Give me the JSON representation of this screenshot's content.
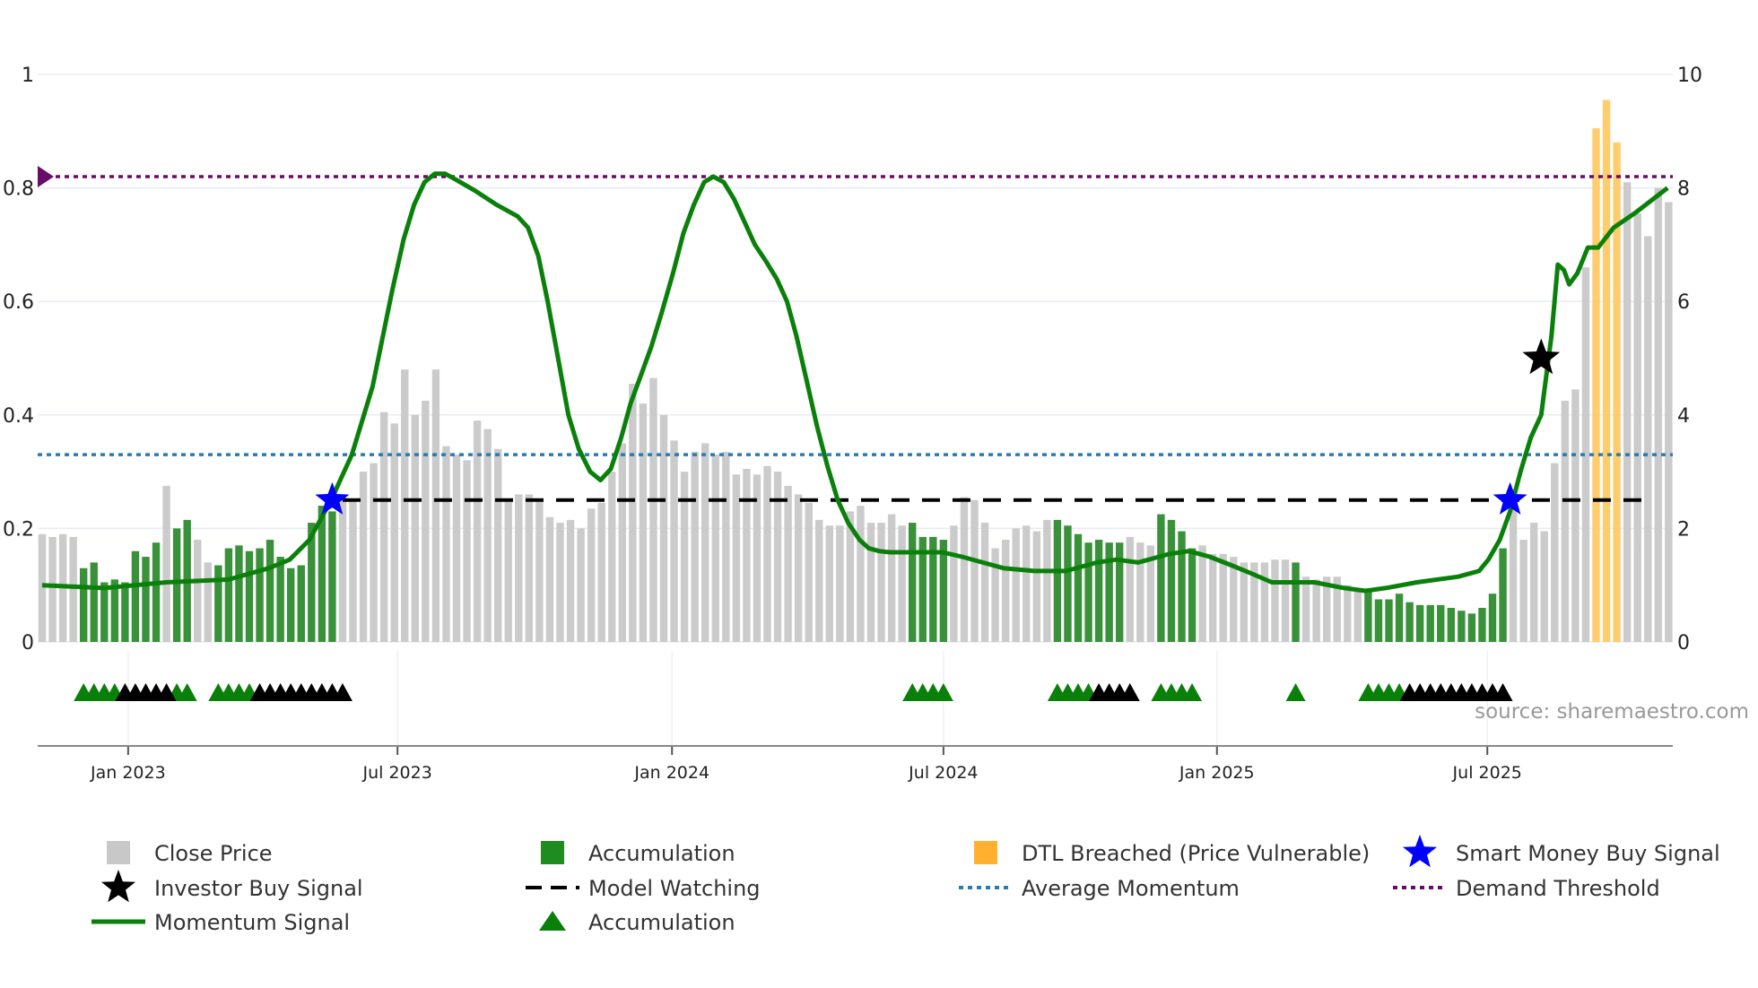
{
  "chart_data": {
    "type": "bar",
    "title": "",
    "xlabel": "",
    "ylabel_left": "",
    "ylabel_right": "",
    "left_axis": {
      "ylim": [
        0,
        1
      ],
      "ticks": [
        "0",
        "0.2",
        "0.4",
        "0.6",
        "0.8",
        "1"
      ],
      "tick_values": [
        0,
        0.2,
        0.4,
        0.6,
        0.8,
        1
      ]
    },
    "right_axis": {
      "ylim": [
        0,
        10
      ],
      "ticks": [
        "0",
        "2",
        "4",
        "6",
        "8",
        "10"
      ],
      "tick_values": [
        0,
        2,
        4,
        6,
        8,
        10
      ]
    },
    "x_ticks": [
      {
        "label": "Jan 2023",
        "week": 8.3
      },
      {
        "label": "Jul 2023",
        "week": 34.3
      },
      {
        "label": "Jan 2024",
        "week": 60.8
      },
      {
        "label": "Jul 2024",
        "week": 87.0
      },
      {
        "label": "Jan 2025",
        "week": 113.4
      },
      {
        "label": "Jul 2025",
        "week": 139.5
      }
    ],
    "close_price": [
      1.9,
      1.85,
      1.9,
      1.85,
      1.3,
      1.4,
      1.05,
      1.1,
      1.05,
      1.6,
      1.5,
      1.75,
      2.75,
      2.0,
      2.15,
      1.8,
      1.4,
      1.35,
      1.65,
      1.7,
      1.6,
      1.65,
      1.8,
      1.5,
      1.3,
      1.35,
      2.1,
      2.4,
      2.3,
      2.6,
      2.5,
      3.0,
      3.15,
      4.05,
      3.85,
      4.8,
      4.0,
      4.25,
      4.8,
      3.45,
      3.3,
      3.2,
      3.9,
      3.75,
      3.4,
      2.5,
      2.6,
      2.6,
      2.5,
      2.2,
      2.1,
      2.15,
      2.0,
      2.35,
      2.45,
      3.0,
      3.5,
      4.55,
      4.2,
      4.65,
      4.0,
      3.55,
      3.0,
      3.35,
      3.5,
      3.3,
      3.35,
      2.95,
      3.05,
      2.95,
      3.1,
      3.0,
      2.75,
      2.6,
      2.45,
      2.15,
      2.05,
      2.05,
      2.3,
      2.4,
      2.1,
      2.1,
      2.25,
      2.05,
      2.1,
      1.85,
      1.85,
      1.8,
      2.05,
      2.55,
      2.5,
      2.1,
      1.65,
      1.8,
      2.0,
      2.05,
      1.95,
      2.15,
      2.15,
      2.05,
      1.9,
      1.75,
      1.8,
      1.75,
      1.75,
      1.85,
      1.75,
      1.7,
      2.25,
      2.15,
      1.95,
      1.65,
      1.7,
      1.55,
      1.55,
      1.5,
      1.4,
      1.4,
      1.4,
      1.45,
      1.45,
      1.4,
      1.15,
      1.1,
      1.15,
      1.15,
      1.0,
      0.95,
      0.9,
      0.75,
      0.75,
      0.85,
      0.7,
      0.65,
      0.65,
      0.65,
      0.6,
      0.55,
      0.5,
      0.6,
      0.85,
      1.65,
      2.45,
      1.8,
      2.1,
      1.95,
      3.15,
      4.25,
      4.45,
      6.6,
      9.05,
      9.55,
      8.8,
      8.1,
      7.55,
      7.15,
      8.0,
      7.75
    ],
    "accumulation_weeks": [
      [
        4,
        11
      ],
      [
        13,
        14
      ],
      [
        17,
        28
      ],
      [
        84,
        87
      ],
      [
        98,
        104
      ],
      [
        108,
        111
      ],
      [
        121,
        121
      ],
      [
        128,
        141
      ]
    ],
    "dtl_breached_weeks": [
      [
        150,
        152
      ]
    ],
    "momentum_signal": [
      [
        0,
        0.1
      ],
      [
        6,
        0.095
      ],
      [
        12,
        0.105
      ],
      [
        18,
        0.11
      ],
      [
        21.9,
        0.13
      ],
      [
        23.9,
        0.145
      ],
      [
        25.8,
        0.18
      ],
      [
        27.9,
        0.25
      ],
      [
        29.9,
        0.33
      ],
      [
        31.9,
        0.45
      ],
      [
        33.8,
        0.62
      ],
      [
        34.9,
        0.71
      ],
      [
        35.9,
        0.77
      ],
      [
        36.9,
        0.81
      ],
      [
        37.9,
        0.825
      ],
      [
        38.9,
        0.825
      ],
      [
        39.9,
        0.815
      ],
      [
        41.8,
        0.795
      ],
      [
        43.9,
        0.77
      ],
      [
        45.9,
        0.75
      ],
      [
        46.9,
        0.73
      ],
      [
        47.9,
        0.68
      ],
      [
        48.8,
        0.6
      ],
      [
        49.8,
        0.5
      ],
      [
        50.8,
        0.4
      ],
      [
        51.8,
        0.34
      ],
      [
        52.9,
        0.3
      ],
      [
        53.9,
        0.285
      ],
      [
        54.9,
        0.305
      ],
      [
        55.9,
        0.36
      ],
      [
        56.8,
        0.42
      ],
      [
        57.8,
        0.47
      ],
      [
        58.8,
        0.52
      ],
      [
        59.8,
        0.58
      ],
      [
        60.9,
        0.65
      ],
      [
        61.9,
        0.72
      ],
      [
        62.9,
        0.77
      ],
      [
        63.9,
        0.81
      ],
      [
        64.8,
        0.82
      ],
      [
        65.8,
        0.81
      ],
      [
        66.8,
        0.78
      ],
      [
        67.8,
        0.74
      ],
      [
        68.8,
        0.7
      ],
      [
        69.9,
        0.67
      ],
      [
        70.9,
        0.64
      ],
      [
        71.9,
        0.6
      ],
      [
        72.8,
        0.54
      ],
      [
        73.8,
        0.46
      ],
      [
        74.8,
        0.38
      ],
      [
        75.8,
        0.31
      ],
      [
        76.8,
        0.25
      ],
      [
        77.8,
        0.21
      ],
      [
        78.9,
        0.18
      ],
      [
        79.8,
        0.165
      ],
      [
        80.8,
        0.16
      ],
      [
        81.8,
        0.158
      ],
      [
        86.9,
        0.158
      ],
      [
        88.8,
        0.15
      ],
      [
        90.8,
        0.14
      ],
      [
        92.8,
        0.13
      ],
      [
        95.8,
        0.125
      ],
      [
        98.8,
        0.125
      ],
      [
        101.8,
        0.14
      ],
      [
        103.7,
        0.145
      ],
      [
        105.8,
        0.14
      ],
      [
        108.8,
        0.155
      ],
      [
        110.7,
        0.16
      ],
      [
        112.7,
        0.15
      ],
      [
        114.8,
        0.135
      ],
      [
        116.8,
        0.12
      ],
      [
        118.7,
        0.105
      ],
      [
        122.8,
        0.105
      ],
      [
        125.7,
        0.095
      ],
      [
        127.7,
        0.09
      ],
      [
        129.7,
        0.095
      ],
      [
        132.7,
        0.105
      ],
      [
        136.7,
        0.115
      ],
      [
        138.7,
        0.125
      ],
      [
        139.6,
        0.145
      ],
      [
        140.7,
        0.18
      ],
      [
        141.7,
        0.23
      ],
      [
        142.7,
        0.3
      ],
      [
        143.7,
        0.36
      ],
      [
        144.7,
        0.4
      ],
      [
        145.7,
        0.54
      ],
      [
        146.3,
        0.665
      ],
      [
        146.9,
        0.655
      ],
      [
        147.4,
        0.63
      ],
      [
        148.2,
        0.65
      ],
      [
        149.2,
        0.695
      ],
      [
        150.2,
        0.695
      ],
      [
        151.7,
        0.73
      ],
      [
        153.7,
        0.755
      ],
      [
        156.9,
        0.8
      ]
    ],
    "demand_threshold": 0.82,
    "average_momentum": 0.33,
    "model_watching": {
      "value": 0.25,
      "from_week": 29,
      "to_week": 155
    },
    "smart_money_buy_signals": [
      [
        28,
        0.25
      ],
      [
        141.7,
        0.25
      ]
    ],
    "investor_buy_signals": [
      [
        144.7,
        0.5
      ]
    ],
    "accumulation_markers": {
      "green": [
        4,
        5,
        6,
        7,
        13,
        14,
        17,
        18,
        19,
        20,
        84,
        85,
        86,
        87,
        98,
        99,
        100,
        101,
        108,
        109,
        110,
        111,
        121,
        128,
        129,
        130,
        131
      ],
      "black": [
        8,
        9,
        10,
        11,
        12,
        21,
        22,
        23,
        24,
        25,
        26,
        27,
        28,
        29,
        102,
        103,
        104,
        105,
        132,
        133,
        134,
        135,
        136,
        137,
        138,
        139,
        140,
        141
      ]
    },
    "colors": {
      "close": "#c8c8c8",
      "accum": "#2e8b2e",
      "dtl": "#ffc966",
      "momentum": "#0a800a",
      "avg": "#2b7bb0",
      "demand": "#6a0a6a",
      "watch": "#000000",
      "smart": "#0000ff"
    },
    "legend_placement": "bottom",
    "legend": [
      {
        "label": "Close Price"
      },
      {
        "label": "Accumulation"
      },
      {
        "label": "DTL Breached (Price Vulnerable)"
      },
      {
        "label": "Smart Money Buy Signal"
      },
      {
        "label": "Investor Buy Signal"
      },
      {
        "label": "Model Watching"
      },
      {
        "label": "Average Momentum"
      },
      {
        "label": "Demand Threshold"
      },
      {
        "label": "Momentum Signal"
      },
      {
        "label": "Accumulation"
      }
    ],
    "source": "source: sharemaestro.com"
  }
}
